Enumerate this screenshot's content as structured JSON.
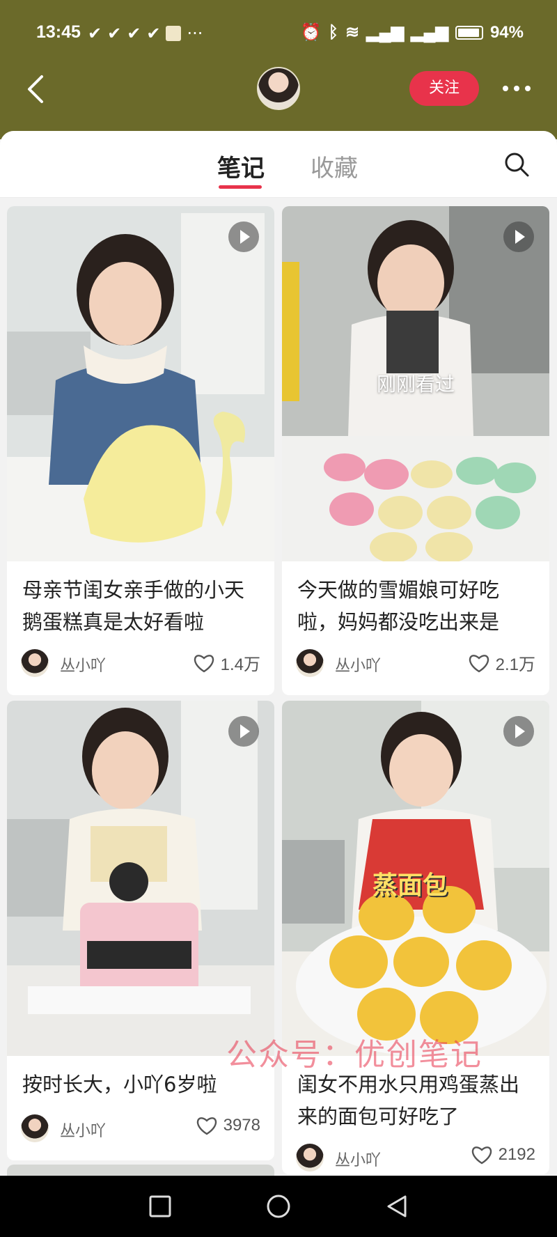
{
  "status_bar": {
    "time": "13:45",
    "battery": "94%",
    "icons": [
      "ellipsis-notification-icon",
      "alarm-icon",
      "bluetooth-icon",
      "wifi-icon",
      "signal-5g-icon",
      "signal-5g-icon",
      "battery-icon"
    ]
  },
  "header": {
    "follow_label": "关注"
  },
  "tabs": [
    {
      "label": "笔记",
      "active": true
    },
    {
      "label": "收藏",
      "active": false
    }
  ],
  "notes": [
    {
      "title": "母亲节闺女亲手做的小天鹅蛋糕真是太好看啦",
      "author": "丛小吖",
      "likes": "1.4万",
      "video": true
    },
    {
      "title": "今天做的雪媚娘可好吃啦，妈妈都没吃出来是",
      "author": "丛小吖",
      "likes": "2.1万",
      "video": true,
      "viewed_label": "刚刚看过"
    },
    {
      "title": "按时长大，小吖6岁啦",
      "author": "丛小吖",
      "likes": "3978",
      "video": true
    },
    {
      "title": "闺女不用水只用鸡蛋蒸出来的面包可好吃了",
      "author": "丛小吖",
      "likes": "2192",
      "video": true,
      "overlay_text": "蒸面包"
    }
  ],
  "watermark": "公众号：优创笔记",
  "colors": {
    "header_bg": "#6b6a2a",
    "accent": "#e8334b"
  }
}
